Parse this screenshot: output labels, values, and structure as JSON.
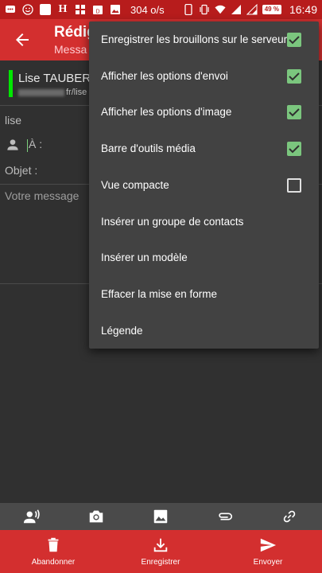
{
  "status_bar": {
    "speed": "304 o/s",
    "battery": "49 %",
    "time": "16:49"
  },
  "app_bar": {
    "title": "Rédig",
    "subtitle": "Messa"
  },
  "compose": {
    "sender_name": "Lise TAUBER",
    "sender_email_suffix": "fr/lise",
    "to_name": "lise",
    "to_label": "À :",
    "subject_label": "Objet :",
    "message_placeholder": "Votre message"
  },
  "menu": {
    "items": [
      {
        "label": "Enregistrer les brouillons sur le serveur",
        "checked": true
      },
      {
        "label": "Afficher les options d'envoi",
        "checked": true
      },
      {
        "label": "Afficher les options d'image",
        "checked": true
      },
      {
        "label": "Barre d'outils média",
        "checked": true
      },
      {
        "label": "Vue compacte",
        "checked": false
      },
      {
        "label": "Insérer un groupe de contacts"
      },
      {
        "label": "Insérer un modèle"
      },
      {
        "label": "Effacer la mise en forme"
      },
      {
        "label": "Légende"
      }
    ]
  },
  "media_toolbar": {
    "icons": [
      "record-audio-icon",
      "camera-icon",
      "image-icon",
      "attachment-icon",
      "link-icon"
    ]
  },
  "bottom_bar": {
    "discard_label": "Abandonner",
    "save_label": "Enregistrer",
    "send_label": "Envoyer"
  },
  "colors": {
    "primary": "#d32f2f",
    "status_bar": "#b71c1c",
    "background": "#303030",
    "menu": "#424242",
    "checkbox": "#7bc67e",
    "identity_bar": "#00e600"
  }
}
